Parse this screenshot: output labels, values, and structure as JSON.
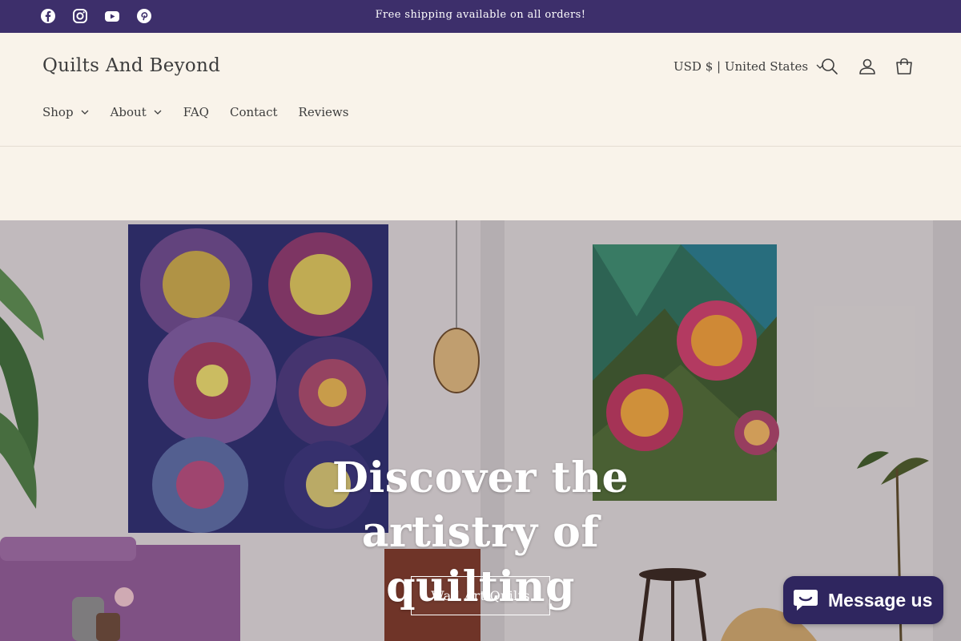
{
  "announcement": {
    "text": "Free shipping available on all orders!",
    "social": [
      "facebook-icon",
      "instagram-icon",
      "youtube-icon",
      "pinterest-icon"
    ]
  },
  "header": {
    "logo": "Quilts And Beyond",
    "currency": "USD $ | United States",
    "nav": [
      {
        "label": "Shop",
        "dropdown": true
      },
      {
        "label": "About",
        "dropdown": true
      },
      {
        "label": "FAQ",
        "dropdown": false
      },
      {
        "label": "Contact",
        "dropdown": false
      },
      {
        "label": "Reviews",
        "dropdown": false
      }
    ],
    "icons": [
      "search-icon",
      "account-icon",
      "cart-icon"
    ]
  },
  "hero": {
    "title_line1": "Discover the artistry of",
    "title_line2": "quilting",
    "button_label": "Wall Art Quilts"
  },
  "chat": {
    "label": "Message us"
  },
  "colors": {
    "announcement_bg": "#3d2f6b",
    "page_bg": "#f9f3ea",
    "chat_bg": "#2f265f"
  }
}
